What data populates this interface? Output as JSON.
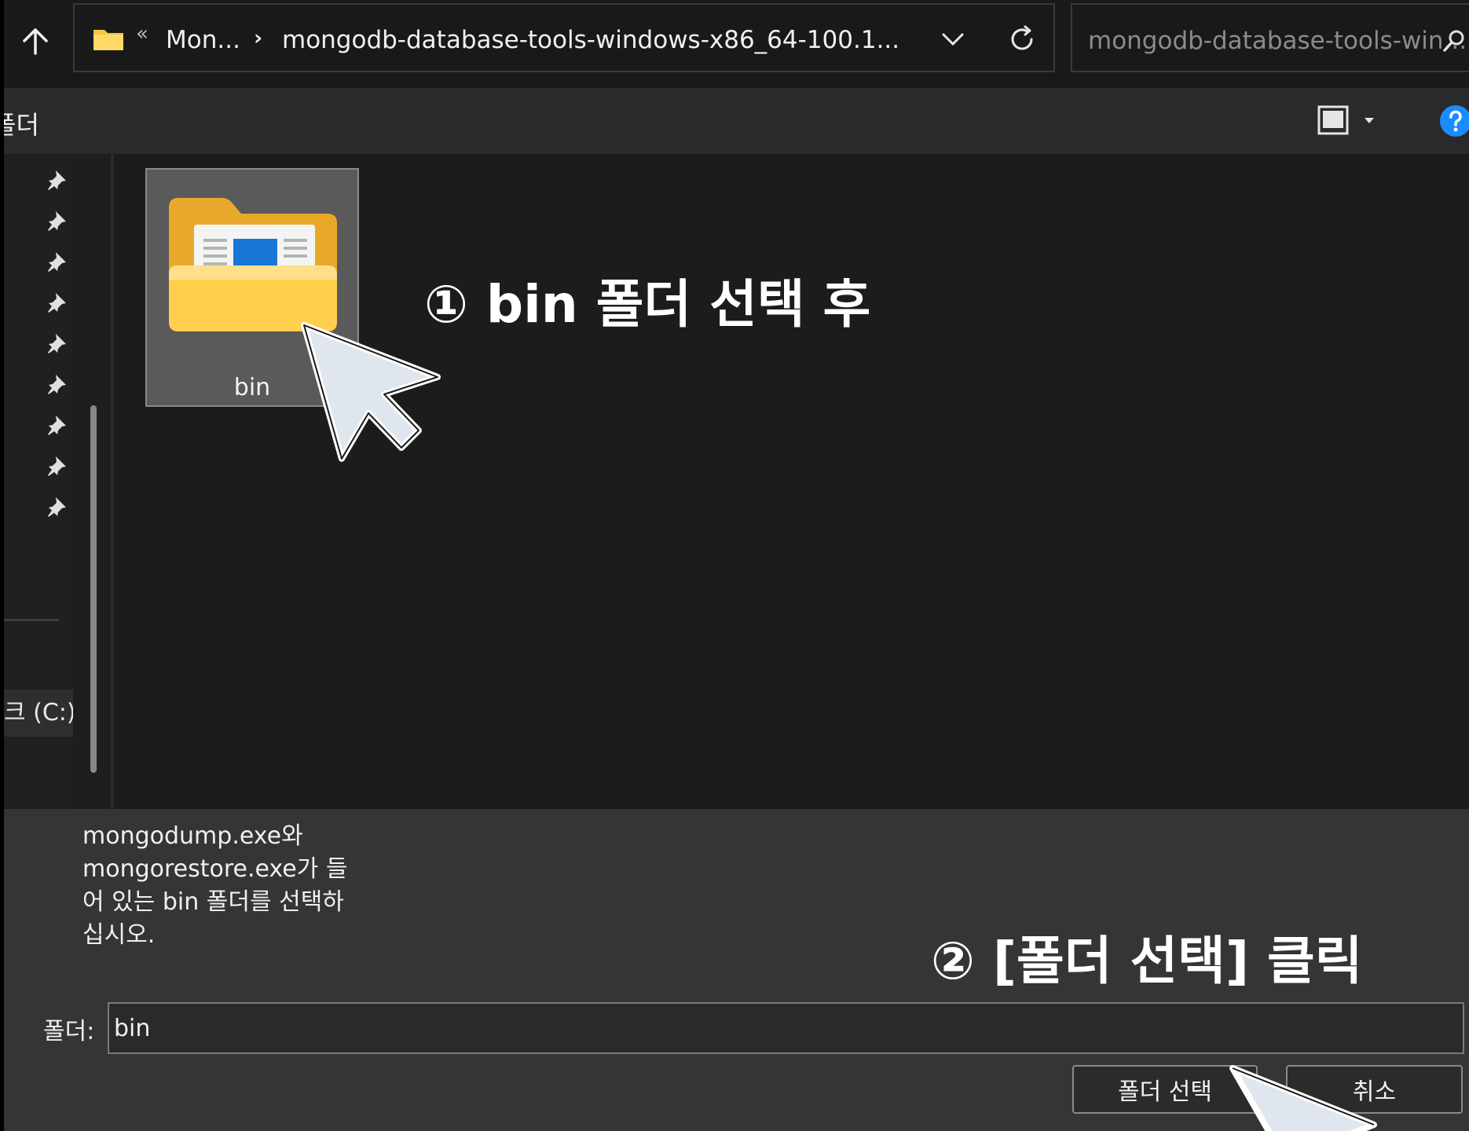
{
  "address_bar": {
    "overflow_glyph": "«",
    "crumbs": [
      "Mon...",
      "mongodb-database-tools-windows-x86_64-100.1..."
    ],
    "separator": "›"
  },
  "search": {
    "placeholder": "mongodb-database-tools-win..."
  },
  "toolbar": {
    "label": "폴더"
  },
  "nav": {
    "pinned_count": 9,
    "drive_label": "크 (C:)"
  },
  "content": {
    "items": [
      {
        "name": "bin",
        "type": "folder",
        "selected": true
      }
    ]
  },
  "annotations": {
    "step1": "① bin 폴더 선택 후",
    "step2": "② [폴더 선택] 클릭"
  },
  "bottom": {
    "description": "mongodump.exe와 mongorestore.exe가 들어 있는 bin 폴더를 선택하십시오.",
    "folder_label": "폴더:",
    "folder_value": "bin",
    "select_button": "폴더 선택",
    "cancel_button": "취소"
  },
  "colors": {
    "background": "#1c1c1c",
    "panel": "#353535",
    "selected_tile": "#5a5a5a",
    "help_accent": "#1a8cff",
    "folder_yellow": "#f5c542"
  }
}
